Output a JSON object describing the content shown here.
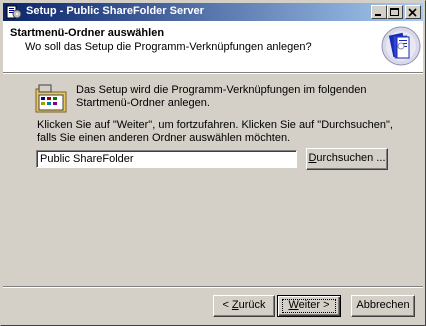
{
  "window": {
    "title": "Setup - Public ShareFolder Server",
    "controls": [
      "minimize",
      "maximize",
      "close"
    ]
  },
  "header": {
    "title": "Startmenü-Ordner auswählen",
    "subtitle": "Wo soll das Setup die Programm-Verknüpfungen anlegen?"
  },
  "body": {
    "info_text": "Das Setup wird die Programm-Verknüpfungen im folgenden Startmenü-Ordner anlegen.",
    "instruction_text": "Klicken Sie auf \"Weiter\", um fortzufahren. Klicken Sie auf \"Durchsuchen\", falls Sie einen anderen Ordner auswählen möchten.",
    "folder_input_value": "Public ShareFolder",
    "browse_label_pre": "",
    "browse_label_key": "D",
    "browse_label_post": "urchsuchen ..."
  },
  "footer": {
    "back_pre": "< ",
    "back_key": "Z",
    "back_post": "urück",
    "next_key": "W",
    "next_post": "eiter >",
    "cancel_label": "Abbrechen"
  },
  "icons": {
    "app": "setup-app-icon",
    "header_logo": "setup-book-cd-icon",
    "folder": "program-group-folder-icon"
  }
}
